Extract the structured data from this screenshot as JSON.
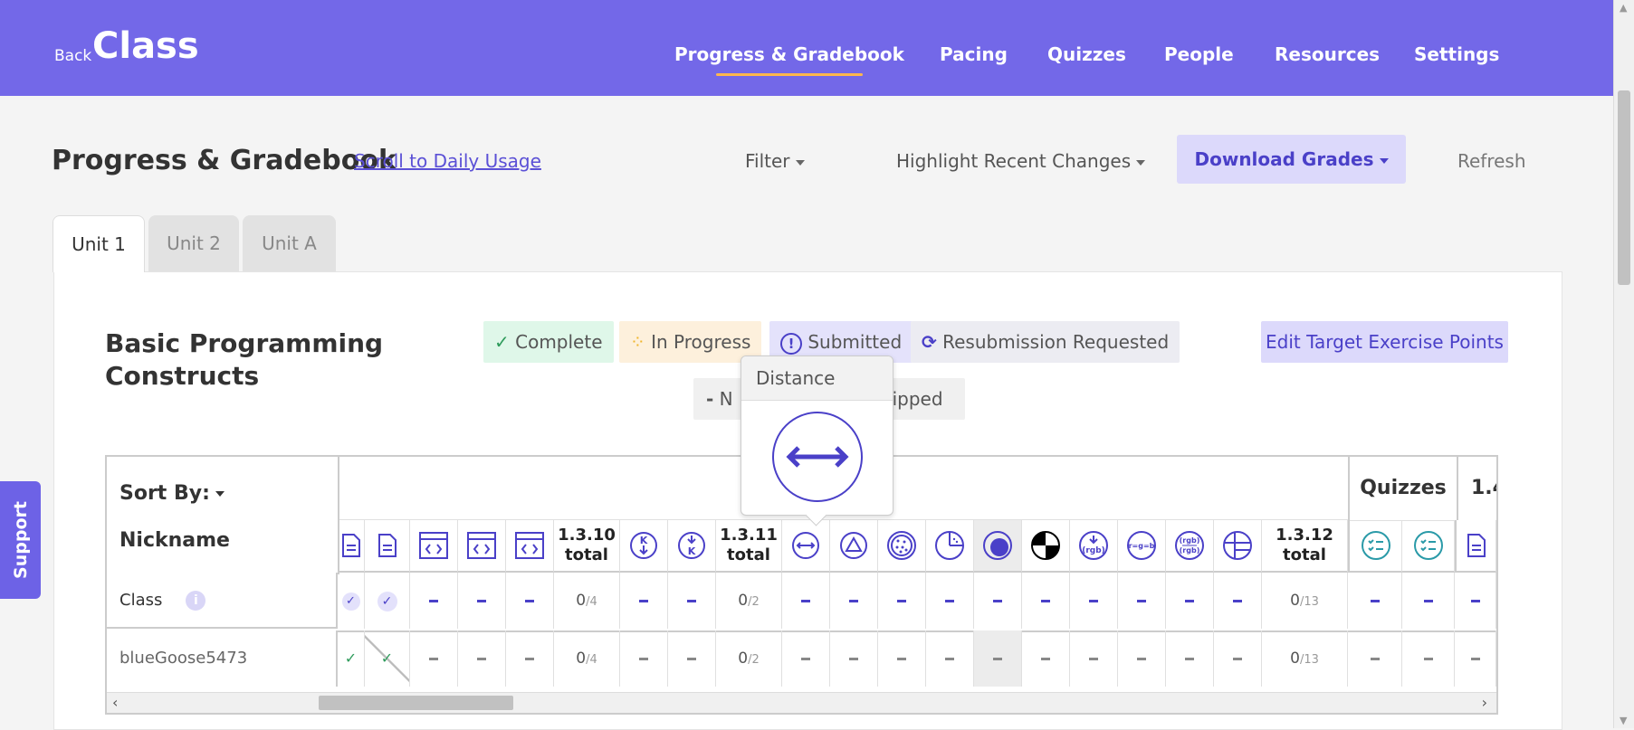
{
  "header": {
    "back_label": "Back",
    "app_title": "Class",
    "nav": [
      {
        "label": "Progress & Gradebook",
        "active": true
      },
      {
        "label": "Pacing"
      },
      {
        "label": "Quizzes"
      },
      {
        "label": "People"
      },
      {
        "label": "Resources"
      },
      {
        "label": "Settings"
      }
    ]
  },
  "toolbar": {
    "page_title": "Progress & Gradebook",
    "scroll_link": "Scroll to Daily Usage",
    "filter": "Filter",
    "highlight": "Highlight Recent Changes",
    "download": "Download Grades",
    "refresh": "Refresh"
  },
  "tabs": [
    "Unit 1",
    "Unit 2",
    "Unit A"
  ],
  "unit": {
    "title": "Basic Programming Constructs",
    "edit_target": "Edit Target Exercise Points"
  },
  "legend": {
    "complete": "Complete",
    "in_progress": "In Progress",
    "submitted": "Submitted",
    "resubmission": "Resubmission Requested",
    "not_started_partial": "N",
    "skipped_partial": "kipped"
  },
  "tooltip": {
    "title": "Distance"
  },
  "grid": {
    "sort_by": "Sort By:",
    "nickname": "Nickname",
    "quizzes_header": "Quizzes",
    "next_header_partial": "1.4",
    "totals": {
      "t1310": [
        "1.3.10",
        "total"
      ],
      "t1311": [
        "1.3.11",
        "total"
      ],
      "t1312": [
        "1.3.12",
        "total"
      ]
    },
    "icon_labels": {
      "rgb": "(rgb)",
      "rgb_equal": "r=g=b",
      "rgb_top": "(rgb)",
      "rgb_bottom": "(rgb)"
    },
    "rows": [
      {
        "label": "Class",
        "frac1310": [
          "0",
          "/4"
        ],
        "frac1311": [
          "0",
          "/2"
        ],
        "frac1312": [
          "0",
          "/13"
        ]
      },
      {
        "label": "blueGoose5473",
        "frac1310": [
          "0",
          "/4"
        ],
        "frac1311": [
          "0",
          "/2"
        ],
        "frac1312": [
          "0",
          "/13"
        ]
      }
    ]
  },
  "support": "Support",
  "colors": {
    "accent": "#7368e8",
    "brand_text": "#4a40c8",
    "complete_bg": "#dff7e9",
    "progress_bg": "#fdf0dc",
    "submitted_bg": "#e4e2fb"
  }
}
